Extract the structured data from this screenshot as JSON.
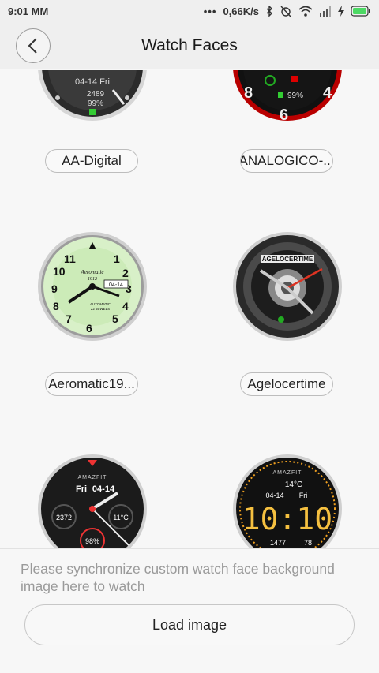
{
  "status": {
    "time": "9:01 MM",
    "network_speed": "0,66K/s",
    "icons": [
      "dots-icon",
      "bluetooth-icon",
      "alarm-off-icon",
      "wifi-icon",
      "signal-icon",
      "charging-icon",
      "battery-icon"
    ],
    "battery_color": "#4cd964"
  },
  "header": {
    "title": "Watch Faces",
    "back_icon": "chevron-left-icon"
  },
  "watch_faces": [
    {
      "label": "AA-Digital",
      "date": "04-14 Fri",
      "steps": "2489",
      "battery": "99%"
    },
    {
      "label": "ANALOGICO-...",
      "battery": "99%"
    },
    {
      "label": "Aeromatic19...",
      "brand": "Aeromatic",
      "year": "1912",
      "date": "04-14",
      "sub": "AUTOMATIC",
      "jewels": "22 JEWELS"
    },
    {
      "label": "Agelocertime",
      "brand": "AGELOCERTIME"
    },
    {
      "label": "",
      "brand": "AMAZFIT",
      "day": "Fri",
      "date": "04-14",
      "steps": "2372",
      "temp": "11°C",
      "battery": "98%"
    },
    {
      "label": "",
      "brand": "AMAZFIT",
      "temp": "14°C",
      "date": "04-14",
      "day": "Fri",
      "time": "10:10",
      "steps": "1477",
      "heart": "78"
    }
  ],
  "bottom": {
    "hint": "Please synchronize custom watch face background image here to watch",
    "load_button": "Load image"
  }
}
